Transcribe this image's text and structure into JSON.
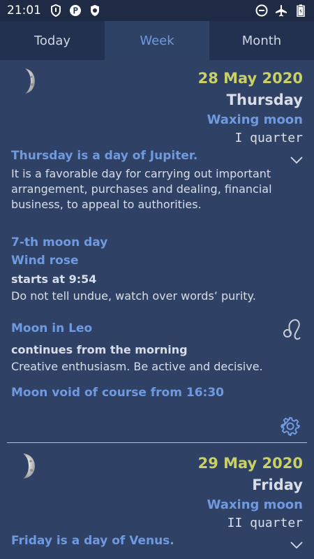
{
  "status_bar": {
    "time": "21:01",
    "icons_left": [
      "shield-icon",
      "parking-icon",
      "security-icon"
    ],
    "icons_right": [
      "do-not-disturb-icon",
      "airplane-icon",
      "battery-icon"
    ]
  },
  "tabs": [
    {
      "label": "Today",
      "active": false
    },
    {
      "label": "Week",
      "active": true
    },
    {
      "label": "Month",
      "active": false
    }
  ],
  "entries": [
    {
      "date": "28 May 2020",
      "weekday": "Thursday",
      "phase": "Waxing moon",
      "quarter": "I quarter",
      "day_of_title": "Thursday is a day of Jupiter.",
      "day_of_text": "It is a favorable day for carrying out important arrangement, purchases and dealing, financial business, to appeal to authorities.",
      "moon_day_title": "7-th moon day",
      "moon_day_symbol": "Wind rose",
      "moon_day_start": "starts at 9:54",
      "moon_day_text": "Do not tell undue, watch over words’ purity.",
      "moon_sign_title": "Moon in Leo",
      "moon_sign_sub": "continues from the morning",
      "moon_sign_text": "Creative enthusiasm. Be active and decisive.",
      "void_text": "Moon void of course from 16:30"
    },
    {
      "date": "29 May 2020",
      "weekday": "Friday",
      "phase": "Waxing moon",
      "quarter": "II quarter",
      "day_of_title": "Friday is a day of Venus."
    }
  ],
  "colors": {
    "background": "#2f4266",
    "accent": "#6f9ae0",
    "date": "#c9d166",
    "tab_bar": "#22314f"
  }
}
